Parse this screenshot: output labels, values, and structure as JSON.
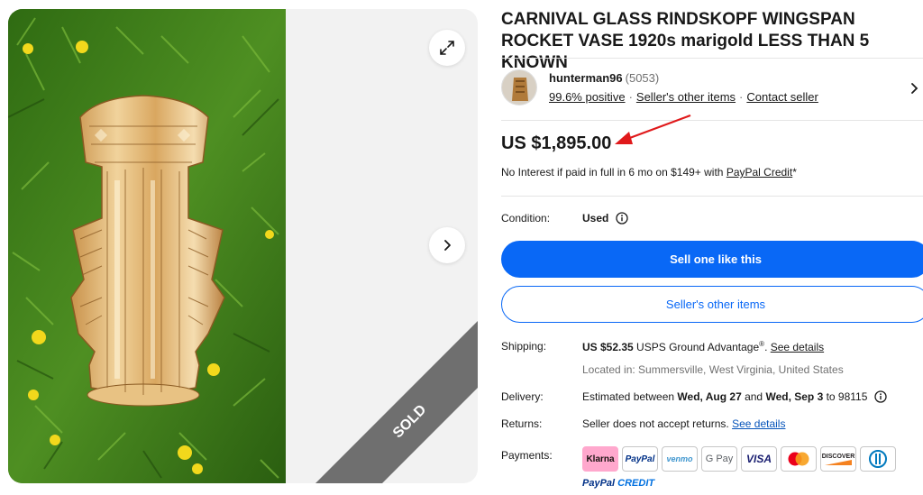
{
  "listing": {
    "title": "CARNIVAL GLASS RINDSKOPF WINGSPAN ROCKET VASE 1920s marigold LESS THAN 5 KNOWN",
    "sold_label": "SOLD"
  },
  "seller": {
    "name": "hunterman96",
    "feedback_count": "(5053)",
    "positive": "99.6% positive",
    "other_items_link": "Seller's other items",
    "contact_link": "Contact seller"
  },
  "price": {
    "amount": "US $1,895.00",
    "financing_prefix": "No Interest if paid in full in 6 mo on $149+ with ",
    "financing_link": "PayPal Credit",
    "financing_suffix": "*"
  },
  "condition": {
    "label": "Condition:",
    "value": "Used"
  },
  "buttons": {
    "sell_one": "Sell one like this",
    "other_items": "Seller's other items"
  },
  "shipping": {
    "label": "Shipping:",
    "cost": "US $52.35",
    "service": " USPS Ground Advantage",
    "sup": "®",
    "details_sep": ". ",
    "details_link": "See details",
    "location": "Located in: Summersville, West Virginia, United States"
  },
  "delivery": {
    "label": "Delivery:",
    "prefix": "Estimated between ",
    "start": "Wed, Aug 27",
    "middle": " and ",
    "end": "Wed, Sep 3",
    "suffix": " to 98115"
  },
  "returns": {
    "label": "Returns:",
    "text": "Seller does not accept returns. ",
    "link": "See details"
  },
  "payments": {
    "label": "Payments:",
    "methods": [
      "Klarna",
      "PayPal",
      "venmo",
      "G Pay",
      "VISA",
      "",
      "DISCOVER",
      ""
    ],
    "paypal_credit_a": "PayPal",
    "paypal_credit_b": " CREDIT"
  },
  "colors": {
    "primary_button": "#0968f6",
    "link_blue": "#0654ba",
    "annotation_arrow": "#e0191b",
    "sold_band": "#707070"
  }
}
